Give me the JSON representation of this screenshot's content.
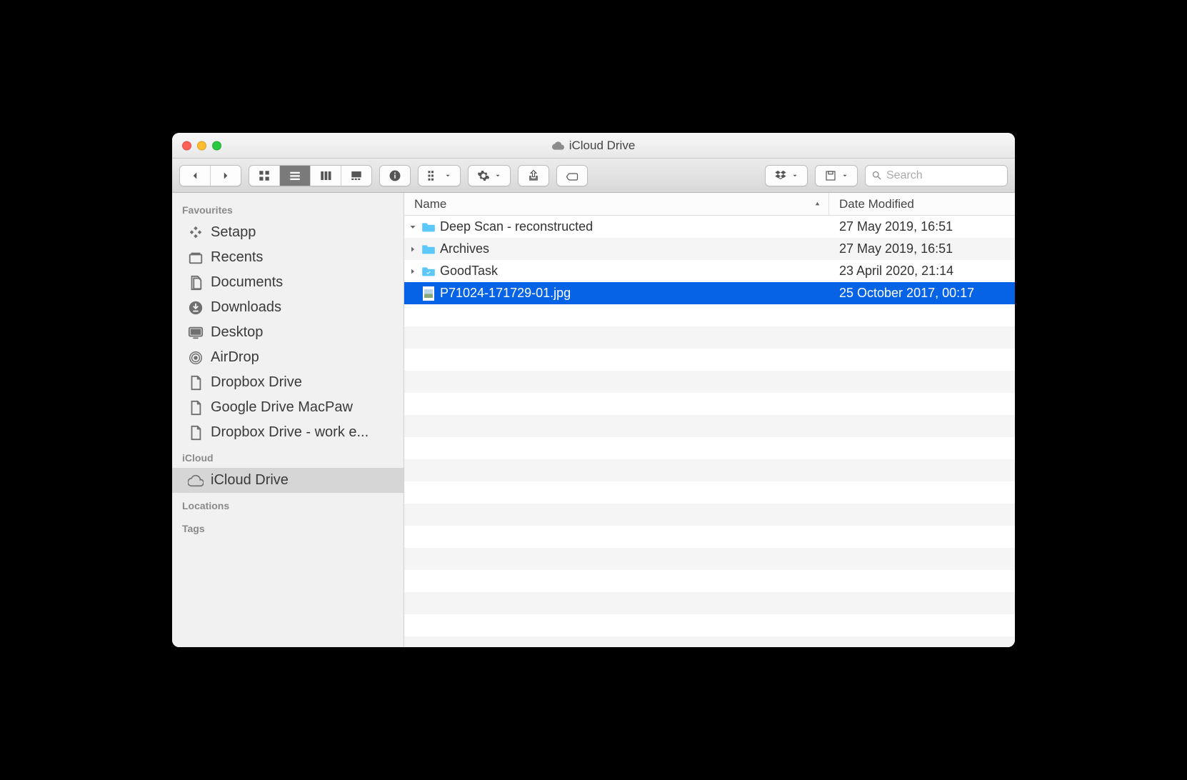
{
  "window": {
    "title": "iCloud Drive"
  },
  "toolbar": {
    "search_placeholder": "Search"
  },
  "sidebar": {
    "sections": [
      {
        "title": "Favourites",
        "items": [
          {
            "icon": "setapp",
            "label": "Setapp"
          },
          {
            "icon": "recents",
            "label": "Recents"
          },
          {
            "icon": "documents",
            "label": "Documents"
          },
          {
            "icon": "downloads",
            "label": "Downloads"
          },
          {
            "icon": "desktop",
            "label": "Desktop"
          },
          {
            "icon": "airdrop",
            "label": "AirDrop"
          },
          {
            "icon": "file",
            "label": "Dropbox Drive"
          },
          {
            "icon": "file",
            "label": "Google Drive MacPaw"
          },
          {
            "icon": "file",
            "label": "Dropbox Drive - work e..."
          }
        ]
      },
      {
        "title": "iCloud",
        "items": [
          {
            "icon": "cloud",
            "label": "iCloud Drive",
            "selected": true
          }
        ]
      },
      {
        "title": "Locations",
        "items": []
      },
      {
        "title": "Tags",
        "items": []
      }
    ]
  },
  "columns": {
    "name": "Name",
    "date": "Date Modified"
  },
  "files": [
    {
      "name": "Deep Scan - reconstructed",
      "date": "27 May 2019, 16:51",
      "type": "folder",
      "indent": 0,
      "expanded": true
    },
    {
      "name": "Archives",
      "date": "27 May 2019, 16:51",
      "type": "folder",
      "indent": 1,
      "expanded": false
    },
    {
      "name": "GoodTask",
      "date": "23 April 2020, 21:14",
      "type": "appfolder",
      "indent": 0,
      "expanded": false
    },
    {
      "name": "P71024-171729-01.jpg",
      "date": "25 October 2017, 00:17",
      "type": "image",
      "indent": 0,
      "selected": true
    }
  ]
}
